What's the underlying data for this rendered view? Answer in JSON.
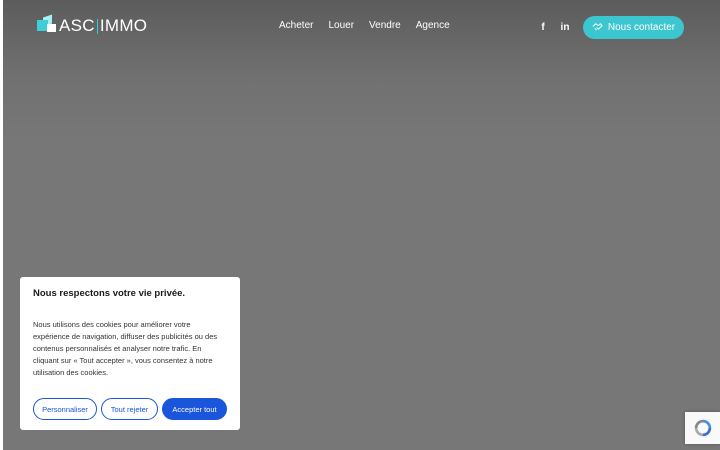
{
  "brand": {
    "logo_left": "ASC",
    "logo_right": "IMMO"
  },
  "nav": {
    "items": [
      {
        "label": "Acheter"
      },
      {
        "label": "Louer"
      },
      {
        "label": "Vendre"
      },
      {
        "label": "Agence"
      }
    ]
  },
  "social": {
    "facebook": "f",
    "linkedin": "in"
  },
  "contact_button": {
    "label": "Nous contacter",
    "icon": "handshake-icon"
  },
  "cookie_banner": {
    "title": "Nous respectons votre vie privée.",
    "text": "Nous utilisons des cookies pour améliorer votre expérience de navigation, diffuser des publicités ou des contenus personnalisés et analyser notre trafic. En cliquant sur « Tout accepter », vous consentez à notre utilisation des cookies.",
    "customize_label": "Personnaliser",
    "reject_label": "Tout rejeter",
    "accept_label": "Accepter tout"
  },
  "colors": {
    "accent": "#3cc6cf",
    "cookie_primary": "#1a56db",
    "hero_bg": "#777777"
  },
  "recaptcha": {
    "icon": "recaptcha-icon"
  }
}
